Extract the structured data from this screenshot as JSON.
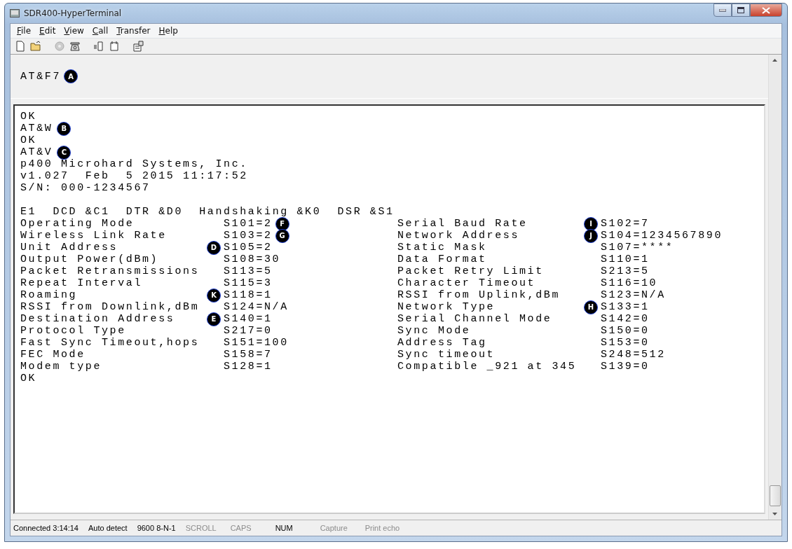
{
  "window": {
    "title": "SDR400-HyperTerminal"
  },
  "menu": [
    "File",
    "Edit",
    "View",
    "Call",
    "Transfer",
    "Help"
  ],
  "terminal": {
    "backscroll": {
      "text": "AT&F7",
      "badge": "A"
    },
    "lines": [
      {
        "text": "OK"
      },
      {
        "text": "AT&W",
        "badge": "B"
      },
      {
        "text": "OK"
      },
      {
        "text": "AT&V",
        "badge": "C"
      },
      {
        "text": "p400 Microhard Systems, Inc."
      },
      {
        "text": "v1.027  Feb  5 2015 11:17:52"
      },
      {
        "text": "S/N: 000-1234567"
      }
    ],
    "settings_line": "E1  DCD &C1  DTR &D0  Handshaking &K0  DSR &S1",
    "registers": [
      {
        "left": {
          "label": "Operating Mode",
          "value": "S101=2",
          "badge_after": "F"
        },
        "right": {
          "label": "Serial Baud Rate",
          "value": "S102=7",
          "badge": "I"
        }
      },
      {
        "left": {
          "label": "Wireless Link Rate",
          "value": "S103=2",
          "badge_after": "G"
        },
        "right": {
          "label": "Network Address",
          "value": "S104=1234567890",
          "badge": "J"
        }
      },
      {
        "left": {
          "label": "Unit Address",
          "value": "S105=2",
          "badge": "D"
        },
        "right": {
          "label": "Static Mask",
          "value": "S107=****"
        }
      },
      {
        "left": {
          "label": "Output Power(dBm)",
          "value": "S108=30"
        },
        "right": {
          "label": "Data Format",
          "value": "S110=1"
        }
      },
      {
        "left": {
          "label": "Packet Retransmissions",
          "value": "S113=5"
        },
        "right": {
          "label": "Packet Retry Limit",
          "value": "S213=5"
        }
      },
      {
        "left": {
          "label": "Repeat Interval",
          "value": "S115=3"
        },
        "right": {
          "label": "Character Timeout",
          "value": "S116=10"
        }
      },
      {
        "left": {
          "label": "Roaming",
          "value": "S118=1",
          "badge": "K"
        },
        "right": {
          "label": "RSSI from Uplink,dBm",
          "value": "S123=N/A"
        }
      },
      {
        "left": {
          "label": "RSSI from Downlink,dBm",
          "value": "S124=N/A"
        },
        "right": {
          "label": "Network Type",
          "value": "S133=1",
          "badge": "H"
        }
      },
      {
        "left": {
          "label": "Destination Address",
          "value": "S140=1",
          "badge": "E"
        },
        "right": {
          "label": "Serial Channel Mode",
          "value": "S142=0"
        }
      },
      {
        "left": {
          "label": "Protocol Type",
          "value": "S217=0"
        },
        "right": {
          "label": "Sync Mode",
          "value": "S150=0"
        }
      },
      {
        "left": {
          "label": "Fast Sync Timeout,hops",
          "value": "S151=100"
        },
        "right": {
          "label": "Address Tag",
          "value": "S153=0"
        }
      },
      {
        "left": {
          "label": "FEC Mode",
          "value": "S158=7"
        },
        "right": {
          "label": "Sync timeout",
          "value": "S248=512"
        }
      },
      {
        "left": {
          "label": "Modem type",
          "value": "S128=1"
        },
        "right": {
          "label": "Compatible _921 at 345",
          "value": "S139=0"
        }
      }
    ],
    "final_line": "OK"
  },
  "status_bar": [
    {
      "text": "Connected 3:14:14",
      "active": true
    },
    {
      "text": "Auto detect",
      "active": true
    },
    {
      "text": "9600 8-N-1",
      "active": true
    },
    {
      "text": "SCROLL",
      "active": false
    },
    {
      "text": "CAPS",
      "active": false
    },
    {
      "text": "NUM",
      "active": true
    },
    {
      "text": "Capture",
      "active": false
    },
    {
      "text": "Print echo",
      "active": false
    }
  ]
}
